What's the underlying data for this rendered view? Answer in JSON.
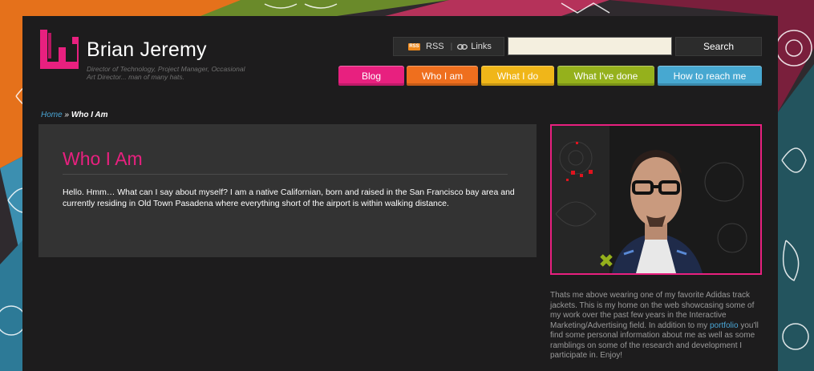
{
  "site": {
    "name": "Brian Jeremy",
    "tagline": "Director of Technology, Project Manager, Occasional Art Director... man of many hats."
  },
  "feeds": {
    "rss_badge": "RSS",
    "rss_label": "RSS",
    "separator": "|",
    "links_label": "Links"
  },
  "search": {
    "value": "",
    "placeholder": "",
    "button_label": "Search"
  },
  "nav": {
    "blog": "Blog",
    "who": "Who I am",
    "what_do": "What I do",
    "what_done": "What I've done",
    "reach": "How to reach me"
  },
  "breadcrumb": {
    "home": "Home",
    "separator": " » ",
    "current": "Who I Am"
  },
  "content": {
    "title": "Who I Am",
    "body": "Hello. Hmm… What can I say about myself? I am a native Californian, born and raised in the San Francisco bay area and currently residing in Old Town Pasadena where everything short of the airport is within walking distance."
  },
  "sidebar": {
    "text_before": "Thats me above wearing one of my favorite Adidas track jackets. This is my home on the web showcasing some of my work over the past few years in the Interactive Marketing/Advertising field. In addition to my ",
    "portfolio_link": "portfolio",
    "text_after": " you'll find some personal information about me as well as some ramblings on some of the research and development I participate in. Enjoy!"
  },
  "colors": {
    "accent_pink": "#e8207f",
    "orange": "#ef6f1e",
    "yellow": "#f0b619",
    "green": "#95b11c",
    "blue": "#47a8d1",
    "link_blue": "#4aa6d6",
    "page_bg": "#1d1c1d"
  }
}
